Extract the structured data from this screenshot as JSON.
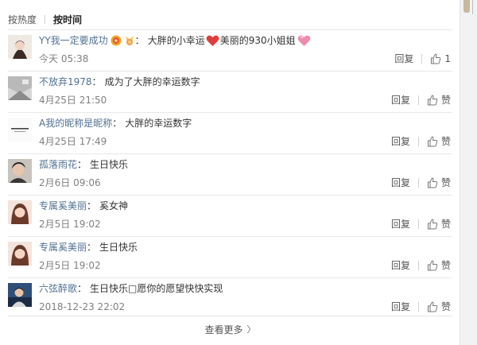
{
  "sort": {
    "hot": "按热度",
    "time": "按时间"
  },
  "comments": [
    {
      "user": "YY我一定要成功",
      "text": "大胖的小幸运",
      "text2": "美丽的930小姐姐",
      "time": "今天 05:38",
      "reply": "回复",
      "like": "1"
    },
    {
      "user": "不放弃1978",
      "text": "成为了大胖的幸运数字",
      "time": "4月25日 21:50",
      "reply": "回复",
      "like": "赞"
    },
    {
      "user": "A我的昵称是昵称",
      "text": "大胖的幸运数字",
      "time": "4月25日 17:49",
      "reply": "回复",
      "like": "赞"
    },
    {
      "user": "孤落雨花",
      "text": "生日快乐",
      "time": "2月6日 09:06",
      "reply": "回复",
      "like": "赞"
    },
    {
      "user": "专属奚美丽",
      "text": "奚女神",
      "time": "2月5日 19:02",
      "reply": "回复",
      "like": "赞"
    },
    {
      "user": "专属奚美丽",
      "text": "生日快乐",
      "time": "2月5日 19:02",
      "reply": "回复",
      "like": "赞"
    },
    {
      "user": "六弦醉歌",
      "text": "生日快乐□愿你的愿望快快实现",
      "time": "2018-12-23 22:02",
      "reply": "回复",
      "like": "赞"
    }
  ],
  "colon": "：",
  "more": {
    "label": "查看更多",
    "chevron": "〉"
  },
  "colors": {
    "username": "#517091",
    "heart": "#e03c3c",
    "pinkHeart": "#f08bb0"
  }
}
